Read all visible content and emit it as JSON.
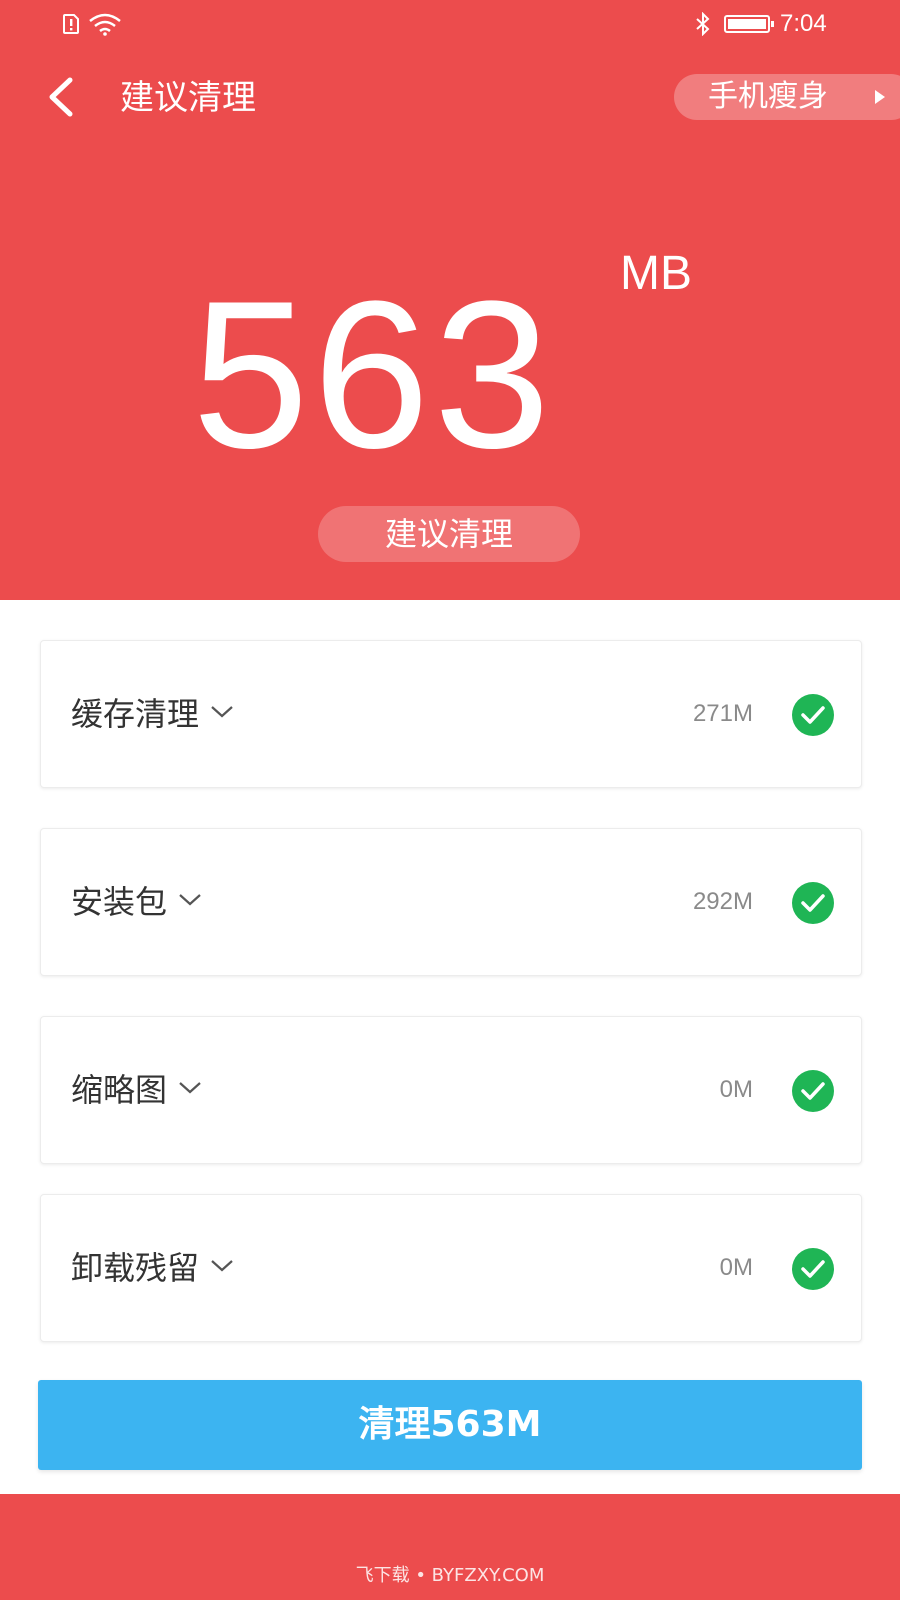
{
  "status_bar": {
    "time": "7:04"
  },
  "header": {
    "back_icon": "chevron-left-icon",
    "title": "建议清理",
    "slim_link_label": "手机瘦身"
  },
  "summary": {
    "size_value": "563",
    "size_unit": "MB",
    "suggestion_label": "建议清理"
  },
  "categories": [
    {
      "label": "缓存清理",
      "size": "271M",
      "checked": true
    },
    {
      "label": "安装包",
      "size": "292M",
      "checked": true
    },
    {
      "label": "缩略图",
      "size": "0M",
      "checked": true
    },
    {
      "label": "卸载残留",
      "size": "0M",
      "checked": true
    }
  ],
  "action": {
    "clean_label": "清理563M"
  },
  "watermark": "飞下载 • BYFZXY.COM",
  "colors": {
    "header_red": "#ec4c4d",
    "button_blue": "#3cb4f1",
    "check_green": "#1fb555"
  }
}
